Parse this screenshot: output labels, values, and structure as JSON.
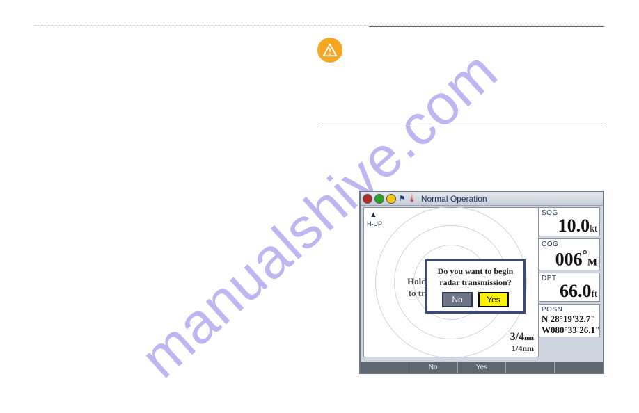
{
  "watermark": "manualshive.com",
  "device": {
    "titlebar": {
      "mode": "Normal Operation",
      "leds": [
        "#b02a2a",
        "#2aa52a",
        "#f5c518"
      ],
      "extra_icons": [
        "bookmark-icon",
        "thermometer-icon"
      ]
    },
    "radar": {
      "orientation": "H-UP",
      "hold_hint_l1": "Hold",
      "hold_hint_l2": "to tr",
      "range_main": "3/4",
      "range_unit": "nm",
      "range_sub": "1/4nm"
    },
    "panels": {
      "sog": {
        "label": "SOG",
        "value": "10.0",
        "unit": "kt"
      },
      "cog": {
        "label": "COG",
        "value": "006",
        "unit": "M"
      },
      "dpt": {
        "label": "DPT",
        "value": "66.0",
        "unit": "ft"
      },
      "posn": {
        "label": "POSN",
        "lat": "N  28°19'32.7\"",
        "lon": "W080°33'26.1\""
      }
    },
    "softkeys": [
      "",
      "No",
      "Yes",
      "",
      ""
    ],
    "dialog": {
      "line1": "Do you want to begin",
      "line2": "radar transmission?",
      "no": "No",
      "yes": "Yes"
    }
  }
}
